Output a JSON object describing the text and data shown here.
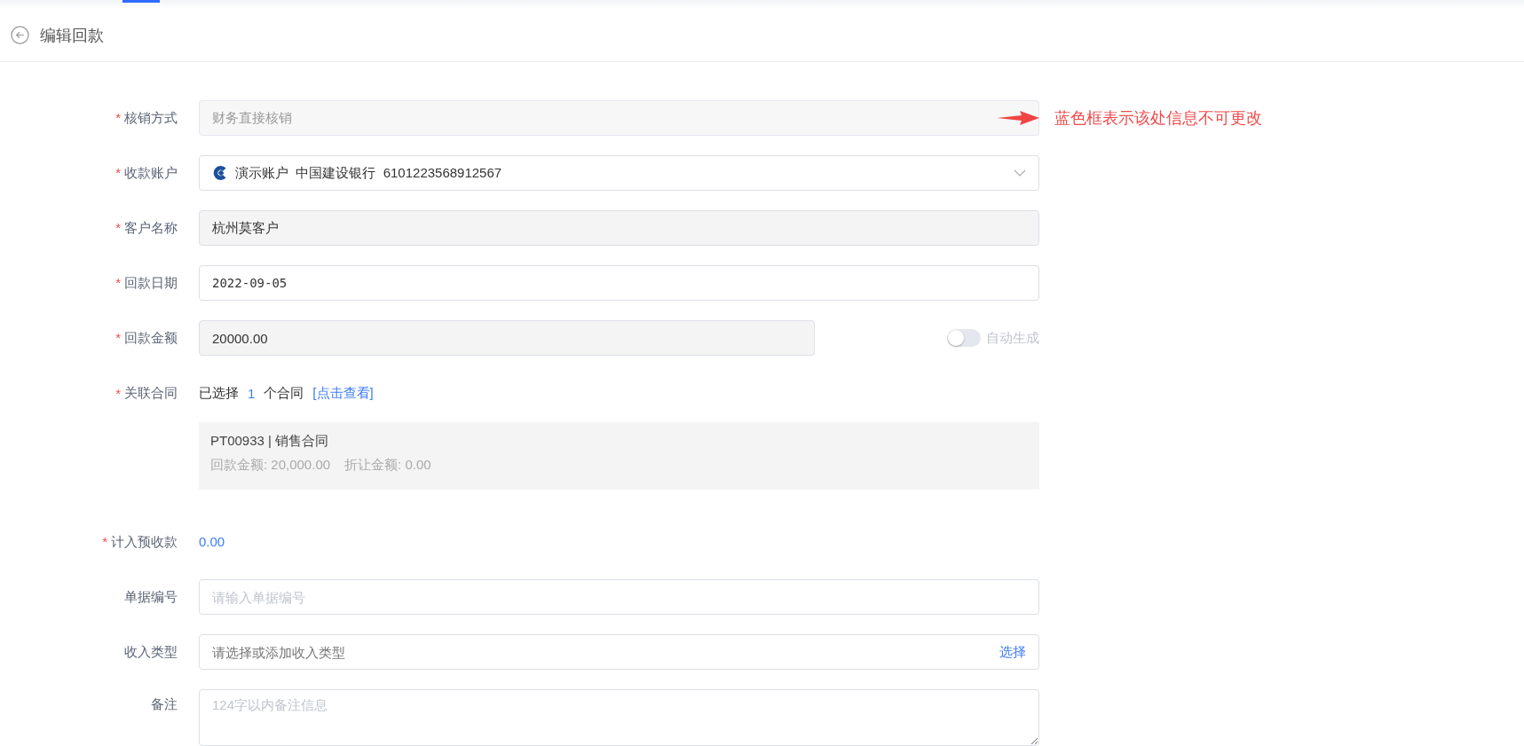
{
  "header": {
    "title": "编辑回款"
  },
  "fields": [
    {
      "kind": "disabled",
      "required_mark": "*",
      "label": "核销方式",
      "value": "财务直接核销",
      "annotation": {
        "text": "蓝色框表示该处信息不可更改"
      }
    },
    {
      "kind": "select",
      "required_mark": "*",
      "label": "收款账户",
      "value": "演示账户  中国建设银行  6101223568912567"
    },
    {
      "kind": "readonly",
      "required_mark": "*",
      "label": "客户名称",
      "value": "杭州莫客户"
    },
    {
      "kind": "input",
      "required_mark": "*",
      "label": "回款日期",
      "value": "2022-09-05"
    },
    {
      "kind": "amount",
      "required_mark": "*",
      "label": "回款金额",
      "value": "20000.00",
      "toggle": {
        "label": "自动生成",
        "on": false
      }
    },
    {
      "kind": "contracts",
      "required_mark": "*",
      "label": "关联合同",
      "prefix": "已选择",
      "count": "1",
      "suffix": "个合同",
      "link": "[点击查看]",
      "contracts": [
        {
          "title": "PT00933 | 销售合同",
          "amount": "回款金额: 20,000.00",
          "discount": "折让金额: 0.00"
        }
      ]
    },
    {
      "kind": "text",
      "required_mark": "*",
      "label": "计入预收款",
      "value": "0.00"
    },
    {
      "kind": "input",
      "label": "单据编号",
      "placeholder": "请输入单据编号"
    },
    {
      "kind": "picker",
      "label": "收入类型",
      "placeholder": "请选择或添加收入类型",
      "action": "选择"
    },
    {
      "kind": "textarea",
      "label": "备注",
      "placeholder": "124字以内备注信息"
    }
  ]
}
